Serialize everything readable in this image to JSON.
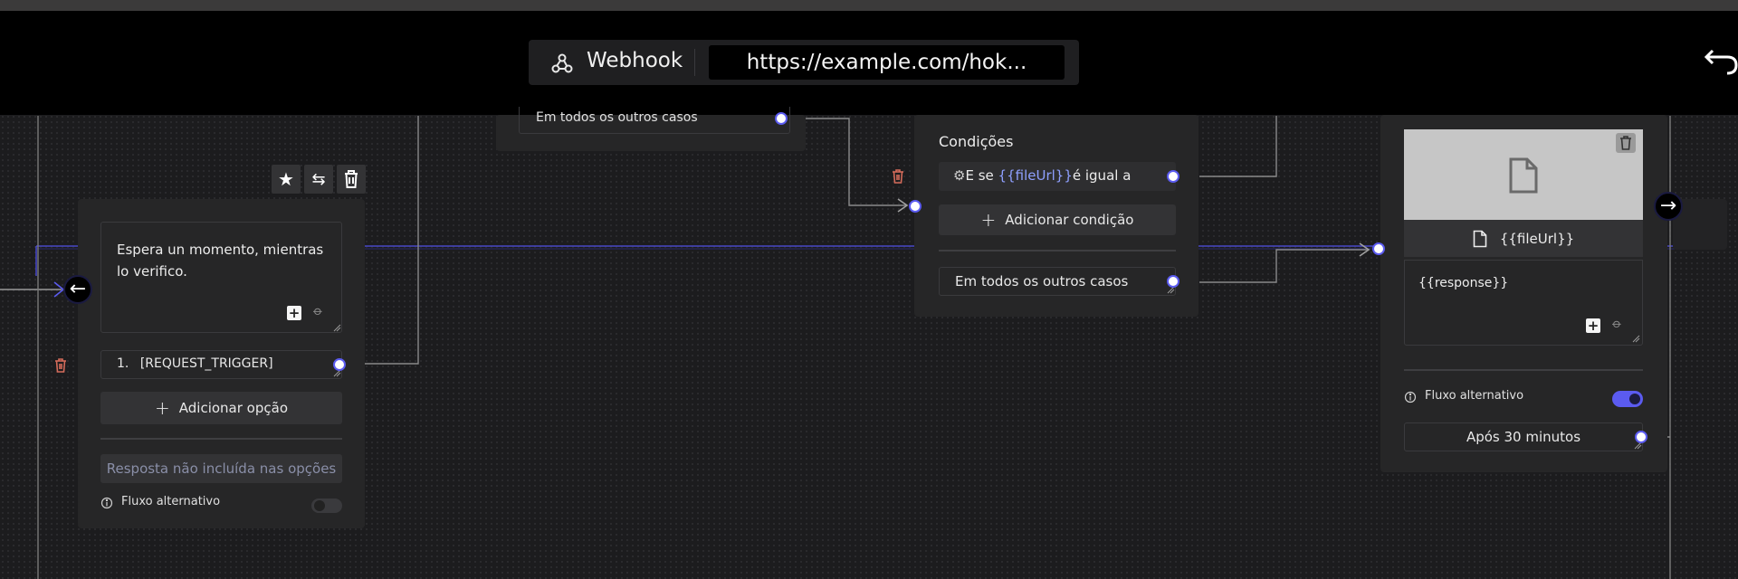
{
  "header": {
    "trigger_label": "Webhook",
    "webhook_url": "https://example.com/hok..."
  },
  "top_node": {
    "fallback_label": "Em todos os outros casos"
  },
  "question_node": {
    "message": "Espera un momento, mientras lo verifico.",
    "option_index": "1.",
    "option_label": "[REQUEST_TRIGGER]",
    "add_option_label": "Adicionar opção",
    "not_included_label": "Resposta não incluída nas opções",
    "alt_flow_label": "Fluxo alternativo",
    "alt_flow_enabled": false
  },
  "conditions_node": {
    "title": "Condições",
    "condition_prefix": "E se",
    "condition_variable": "{{fileUrl}}",
    "condition_operator": "é igual a",
    "add_condition_label": "Adicionar condição",
    "fallback_label": "Em todos os outros casos"
  },
  "file_node": {
    "file_variable": "{{fileUrl}}",
    "message": "{{response}}",
    "alt_flow_label": "Fluxo alternativo",
    "alt_flow_enabled": true,
    "timeout_label": "Após 30 minutos"
  },
  "colors": {
    "accent": "#5b5bf0",
    "variable": "#8fa0ff",
    "danger": "#d46b5a",
    "node_bg": "#262627",
    "canvas_bg": "#1c1c1e"
  },
  "icons": [
    "webhook-icon",
    "undo-icon",
    "star-icon",
    "swap-icon",
    "trash-icon",
    "plus-square-icon",
    "paperclip-icon",
    "file-icon",
    "info-icon",
    "gear-icon",
    "arrow-left-icon",
    "arrow-right-icon"
  ]
}
